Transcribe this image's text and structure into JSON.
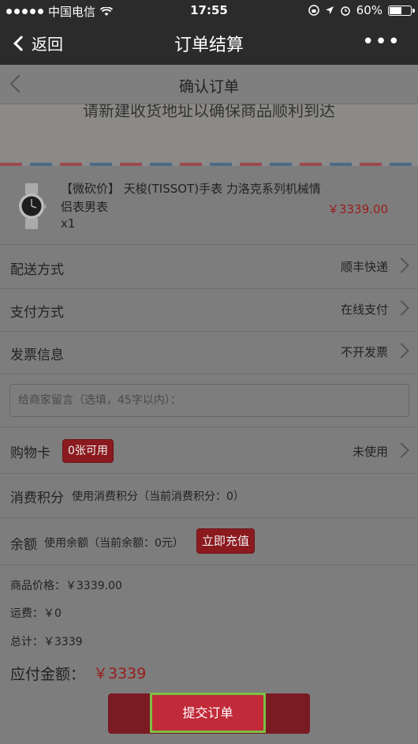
{
  "status_bar": {
    "carrier": "中国电信",
    "time": "17:55",
    "battery": "60%",
    "battery_level": 0.6
  },
  "nav": {
    "back_label": "返回",
    "title": "订单结算",
    "more": "•••"
  },
  "page": {
    "title": "确认订单"
  },
  "address": {
    "prompt": "请新建收货地址以确保商品顺利到达"
  },
  "product": {
    "name": "【微砍价】 天梭(TISSOT)手表 力洛克系列机械情侣表男表",
    "qty": "x1",
    "price": "￥3339.00"
  },
  "delivery": {
    "label": "配送方式",
    "value": "顺丰快递"
  },
  "payment": {
    "label": "支付方式",
    "value": "在线支付"
  },
  "invoice": {
    "label": "发票信息",
    "value": "不开发票"
  },
  "message": {
    "placeholder": "给商家留言（选填，45字以内）："
  },
  "shopping_card": {
    "label": "购物卡",
    "badge": "0张可用",
    "value": "未使用"
  },
  "points": {
    "label": "消费积分",
    "detail": "使用消费积分（当前消费积分：0）"
  },
  "balance": {
    "label": "余额",
    "detail": "使用余额（当前余额：0元）",
    "recharge": "立即充值"
  },
  "summary": {
    "goods_price": "商品价格：￥3339.00",
    "shipping": "运费：￥0",
    "total": "总计：￥3339",
    "payable_label": "应付金额：",
    "payable_value": "￥3339"
  },
  "submit": {
    "label": "提交订单"
  }
}
